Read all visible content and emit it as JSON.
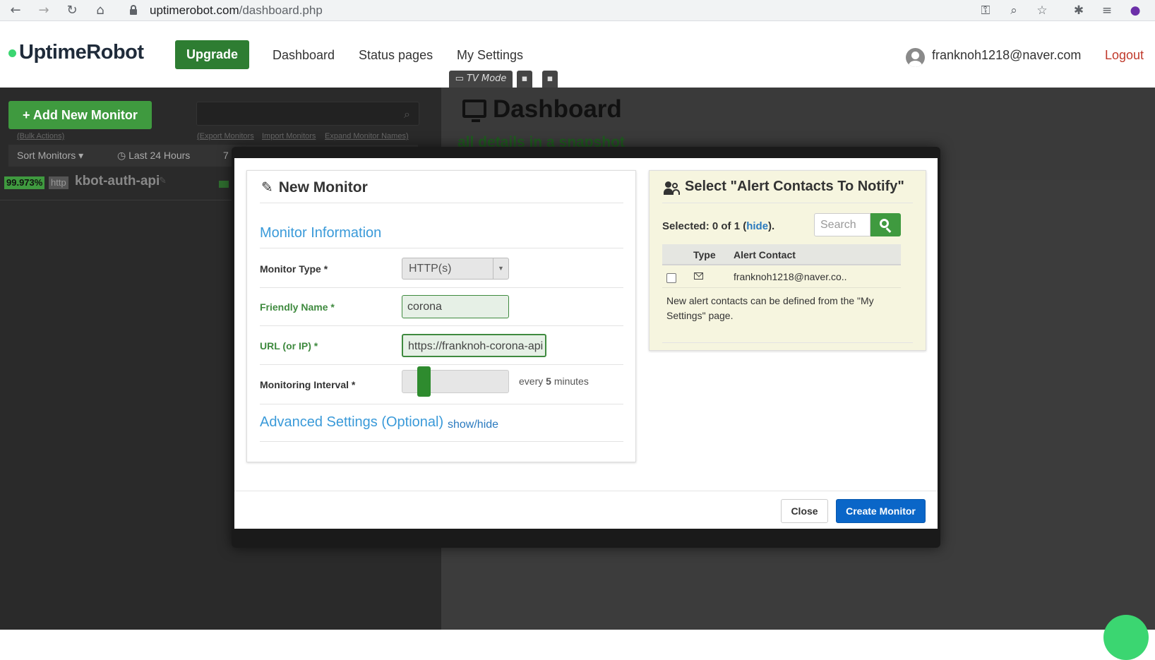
{
  "browser": {
    "url_domain": "uptimerobot.com",
    "url_path": "/dashboard.php"
  },
  "header": {
    "logo": "UptimeRobot",
    "upgrade_label": "Upgrade",
    "nav": [
      "Dashboard",
      "Status pages",
      "My Settings"
    ],
    "user_email": "franknoh1218@naver.com",
    "logout_label": "Logout",
    "tv_mode_label": "TV Mode"
  },
  "sidebar": {
    "add_monitor_label": "+ Add New Monitor",
    "bulk_actions": "(Bulk Actions)",
    "export_monitors": "(Export Monitors",
    "import_monitors": "Import Monitors",
    "expand_names": "Expand Monitor Names)",
    "sort_label": "Sort Monitors",
    "range_label": "Last 24 Hours",
    "range_extra": "7",
    "monitor": {
      "uptime": "99.973%",
      "type": "http",
      "name": "kbot-auth-api"
    }
  },
  "dashboard": {
    "title": "Dashboard",
    "subtitle": "all details in a snapshot"
  },
  "modal": {
    "title": "New Monitor",
    "section_title": "Monitor Information",
    "monitor_type_label": "Monitor Type *",
    "monitor_type_value": "HTTP(s)",
    "friendly_name_label": "Friendly Name *",
    "friendly_name_value": "corona",
    "url_label": "URL (or IP) *",
    "url_value": "https://franknoh-corona-api",
    "interval_label": "Monitoring Interval *",
    "interval_prefix": "every",
    "interval_value": "5",
    "interval_suffix": "minutes",
    "advanced_title": "Advanced Settings (Optional)",
    "advanced_toggle": "show/hide",
    "close_label": "Close",
    "create_label": "Create Monitor"
  },
  "alerts": {
    "title": "Select \"Alert Contacts To Notify\"",
    "selected_prefix": "Selected: 0 of 1 (",
    "selected_link": "hide",
    "selected_suffix": ").",
    "search_placeholder": "Search",
    "col_type": "Type",
    "col_contact": "Alert Contact",
    "rows": [
      {
        "contact": "franknoh1218@naver.co.."
      }
    ],
    "note": "New alert contacts can be defined from the \"My Settings\" page."
  },
  "colors": {
    "brand_green": "#3bd671",
    "primary_blue": "#0a66c8",
    "link_blue": "#3a9ad9"
  }
}
